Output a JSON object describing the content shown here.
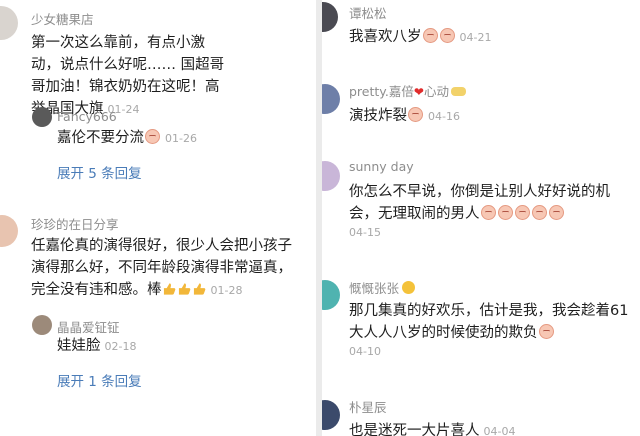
{
  "left": {
    "comments": [
      {
        "user": "少女糖果店",
        "text": "第一次这么靠前，有点小激动，说点什么好呢…… 国超哥哥加油！锦衣奶奶在这呢！高举晶国大旗",
        "date": "01-24",
        "reply": {
          "user": "Fancy666",
          "text": "嘉伦不要分流",
          "date": "01-26"
        },
        "expand": "展开 5 条回复"
      },
      {
        "user": "珍珍的在日分享",
        "text": "任嘉伦真的演得很好，很少人会把小孩子演得那么好，不同年龄段演得非常逼真，完全没有违和感。棒",
        "date": "01-28",
        "reply": {
          "user": "晶晶爱钲钲",
          "text": "娃娃脸",
          "date": "02-18"
        },
        "expand": "展开 1 条回复"
      }
    ]
  },
  "right": {
    "comments": [
      {
        "user": "谭松松",
        "text": "我喜欢八岁",
        "date": "04-21"
      },
      {
        "user": "pretty.嘉倍",
        "user_suffix": "心动",
        "text": "演技炸裂",
        "date": "04-16"
      },
      {
        "user": "sunny day",
        "text": "你怎么不早说，你倒是让别人好好说的机会，无理取闹的男人",
        "date": "04-15"
      },
      {
        "user": "慨慨张张",
        "text": "那几集真的好欢乐，估计是我，我会趁着61大人人八岁的时候使劲的欺负",
        "date": "04-10"
      },
      {
        "user": "朴星辰",
        "text": "也是迷死一大片喜人",
        "date": "04-04"
      }
    ]
  },
  "colors": {
    "link": "#4a7cb8",
    "username": "#8d8d8d",
    "date": "#a8a8a8",
    "text": "#1e1e1e"
  },
  "icons": [
    "user-avatar",
    "laughing-emoji",
    "thumbs-up-emoji",
    "heart-emoji",
    "sun-emoji"
  ]
}
